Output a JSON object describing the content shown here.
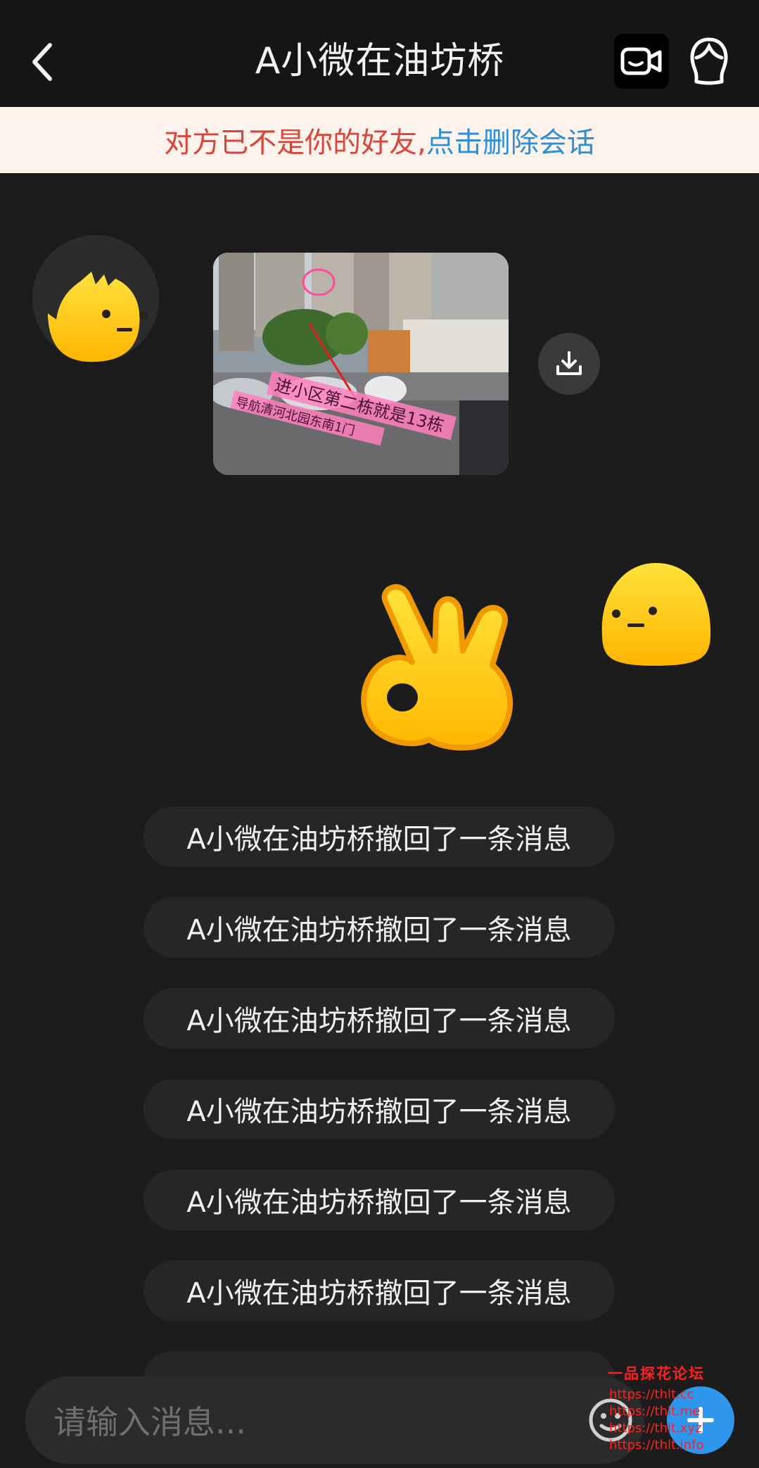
{
  "header": {
    "title": "A小微在油坊桥"
  },
  "notice": {
    "warning_text": "对方已不是你的好友,",
    "action_text": "点击删除会话"
  },
  "image_message": {
    "overlay_line1": "进小区第二栋就是13栋",
    "overlay_line2": "导航清河北园东南1门"
  },
  "recalls": [
    "A小微在油坊桥撤回了一条消息",
    "A小微在油坊桥撤回了一条消息",
    "A小微在油坊桥撤回了一条消息",
    "A小微在油坊桥撤回了一条消息",
    "A小微在油坊桥撤回了一条消息",
    "A小微在油坊桥撤回了一条消息"
  ],
  "input": {
    "placeholder": "请输入消息..."
  },
  "watermark": {
    "title": "一品探花论坛",
    "links": [
      "https://thlt.cc",
      "https://thlt.me",
      "https://thlt.xyz",
      "https://thlt.info"
    ]
  },
  "colors": {
    "background": "#1c1c1c",
    "header": "#151515",
    "notice_bg": "#fdf3ec",
    "warning": "#d9453a",
    "link": "#2f8fd6",
    "accent": "#2f96ee",
    "emoji_yellow": "#ffcc00"
  },
  "icons": {
    "back": "chevron-left-icon",
    "video": "video-camera-icon",
    "profile": "user-profile-icon",
    "download": "download-icon",
    "emoji": "emoji-face-icon",
    "plus": "plus-icon"
  }
}
